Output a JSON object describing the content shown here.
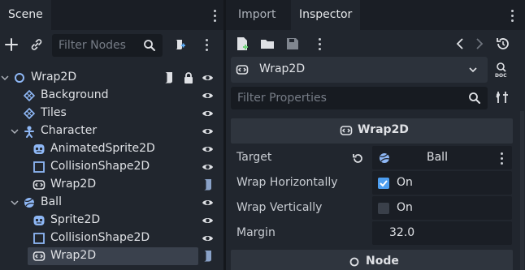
{
  "scene_dock": {
    "tab_label": "Scene",
    "filter_placeholder": "Filter Nodes",
    "tree": [
      {
        "label": "Wrap2D",
        "icon": "node-circle-icon"
      },
      {
        "label": "Background",
        "icon": "tilemap-icon"
      },
      {
        "label": "Tiles",
        "icon": "tilemap-icon"
      },
      {
        "label": "Character",
        "icon": "character-icon"
      },
      {
        "label": "AnimatedSprite2D",
        "icon": "sprite-icon"
      },
      {
        "label": "CollisionShape2D",
        "icon": "collision-shape-icon"
      },
      {
        "label": "Wrap2D",
        "icon": "wrap2d-icon"
      },
      {
        "label": "Ball",
        "icon": "ball-icon"
      },
      {
        "label": "Sprite2D",
        "icon": "sprite-icon"
      },
      {
        "label": "CollisionShape2D",
        "icon": "collision-shape-icon"
      },
      {
        "label": "Wrap2D",
        "icon": "wrap2d-icon",
        "selected": true
      }
    ]
  },
  "inspector_dock": {
    "tabs": [
      {
        "label": "Import",
        "active": false
      },
      {
        "label": "Inspector",
        "active": true
      }
    ],
    "object_name": "Wrap2D",
    "filter_placeholder": "Filter Properties",
    "section_title": "Wrap2D",
    "properties": {
      "target": {
        "label": "Target",
        "value": "Ball"
      },
      "wrap_h": {
        "label": "Wrap Horizontally",
        "value": "On",
        "checked": true
      },
      "wrap_v": {
        "label": "Wrap Vertically",
        "value": "On",
        "checked": false
      },
      "margin": {
        "label": "Margin",
        "value": "32.0"
      }
    },
    "next_section_title": "Node"
  },
  "colors": {
    "accent": "#4d9ef0",
    "script": "#8aa2c8",
    "background": "#21262e"
  }
}
